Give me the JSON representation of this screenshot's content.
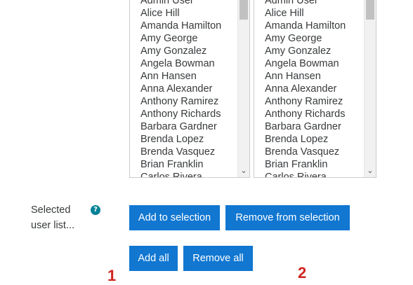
{
  "listbox_left": {
    "options": [
      "Admin User",
      "Alice Hill",
      "Amanda Hamilton",
      "Amy George",
      "Amy Gonzalez",
      "Angela Bowman",
      "Ann Hansen",
      "Anna Alexander",
      "Anthony Ramirez",
      "Anthony Richards",
      "Barbara Gardner",
      "Brenda Lopez",
      "Brenda Vasquez",
      "Brian Franklin",
      "Carlos Rivera"
    ]
  },
  "listbox_right": {
    "options": [
      "Admin User",
      "Alice Hill",
      "Amanda Hamilton",
      "Amy George",
      "Amy Gonzalez",
      "Angela Bowman",
      "Ann Hansen",
      "Anna Alexander",
      "Anthony Ramirez",
      "Anthony Richards",
      "Barbara Gardner",
      "Brenda Lopez",
      "Brenda Vasquez",
      "Brian Franklin",
      "Carlos Rivera"
    ]
  },
  "field": {
    "label": "Selected user list...",
    "help_icon": "question-mark"
  },
  "buttons": {
    "add_to_selection": "Add to selection",
    "remove_from_selection": "Remove from selection",
    "add_all": "Add all",
    "remove_all": "Remove all"
  },
  "markers": {
    "first": "1",
    "second": "2"
  },
  "colors": {
    "button_bg": "#1177d1",
    "help_icon": "#008196",
    "marker": "#d0241f"
  }
}
